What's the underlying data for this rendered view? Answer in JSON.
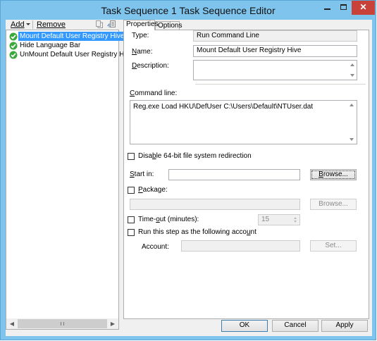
{
  "window": {
    "title": "Task Sequence 1 Task Sequence Editor"
  },
  "toolbar": {
    "add_label": "Add",
    "remove_label": "Remove"
  },
  "tree": {
    "items": [
      {
        "label": "Mount Default User Registry Hive",
        "selected": true,
        "icon": "green-check-icon"
      },
      {
        "label": "Hide Language Bar",
        "selected": false,
        "icon": "green-check-icon"
      },
      {
        "label": "UnMount Default User Registry Hive",
        "selected": false,
        "icon": "green-check-icon"
      }
    ]
  },
  "tabs": [
    {
      "label": "Properties",
      "active": true
    },
    {
      "label": "Options",
      "active": false
    }
  ],
  "properties": {
    "type_label": "Type:",
    "type_value": "Run Command Line",
    "name_label": "Name:",
    "name_value": "Mount Default User Registry Hive",
    "description_label": "Description:",
    "description_value": "",
    "command_line_label": "Command line:",
    "command_line_value": "Reg.exe Load HKU\\DefUser C:\\Users\\Default\\NTUser.dat",
    "disable_64bit_label": "Disable 64-bit file system redirection",
    "disable_64bit_checked": false,
    "start_in_label": "Start in:",
    "start_in_value": "",
    "browse_label": "Browse...",
    "package_label": "Package:",
    "package_checked": false,
    "package_value": "",
    "package_browse_label": "Browse...",
    "timeout_label": "Time-out (minutes):",
    "timeout_checked": false,
    "timeout_value": "15",
    "run_as_label": "Run this step as the following account",
    "run_as_checked": false,
    "account_label": "Account:",
    "account_value": "",
    "set_label": "Set..."
  },
  "footer": {
    "ok_label": "OK",
    "cancel_label": "Cancel",
    "apply_label": "Apply"
  },
  "colors": {
    "titlebar": "#7fc4ec",
    "close_button": "#c8423a",
    "selection": "#3399ff",
    "check_icon": "#3aa83a"
  }
}
